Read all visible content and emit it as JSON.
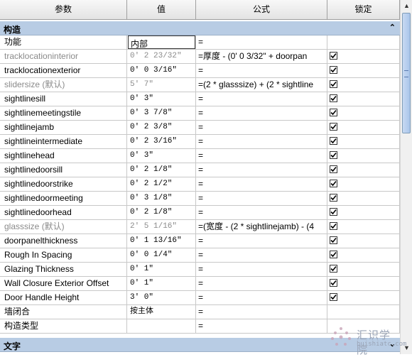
{
  "header": {
    "col_param": "参数",
    "col_value": "值",
    "col_formula": "公式",
    "col_lock": "锁定"
  },
  "groups": {
    "construction": "构造",
    "text": "文字",
    "collapse_icon": "chevron-double-up-icon"
  },
  "rows": [
    {
      "param": "功能",
      "value": "内部",
      "formula": "=",
      "checked": false,
      "editing": true,
      "gray": false
    },
    {
      "param": "tracklocationinterior",
      "value": "0'  2 23/32\"",
      "formula": "=厚度 - (0'  0 3/32\" + doorpan",
      "checked": true,
      "gray": true
    },
    {
      "param": "tracklocationexterior",
      "value": "0'  0 3/16\"",
      "formula": "=",
      "checked": true,
      "gray": false
    },
    {
      "param": "slidersize (默认)",
      "value": "5'  7\"",
      "formula": "=(2 * glasssize) + (2 * sightline",
      "checked": true,
      "gray": true
    },
    {
      "param": "sightlinesill",
      "value": "0'  3\"",
      "formula": "=",
      "checked": true,
      "gray": false
    },
    {
      "param": "sightlinemeetingstile",
      "value": "0'  3 7/8\"",
      "formula": "=",
      "checked": true,
      "gray": false
    },
    {
      "param": "sightlinejamb",
      "value": "0'  2 3/8\"",
      "formula": "=",
      "checked": true,
      "gray": false
    },
    {
      "param": "sightlineintermediate",
      "value": "0'  2 3/16\"",
      "formula": "=",
      "checked": true,
      "gray": false
    },
    {
      "param": "sightlinehead",
      "value": "0'  3\"",
      "formula": "=",
      "checked": true,
      "gray": false
    },
    {
      "param": "sightlinedoorsill",
      "value": "0'  2 1/8\"",
      "formula": "=",
      "checked": true,
      "gray": false
    },
    {
      "param": "sightlinedoorstrike",
      "value": "0'  2 1/2\"",
      "formula": "=",
      "checked": true,
      "gray": false
    },
    {
      "param": "sightlinedoormeeting",
      "value": "0'  3 1/8\"",
      "formula": "=",
      "checked": true,
      "gray": false
    },
    {
      "param": "sightlinedoorhead",
      "value": "0'  2 1/8\"",
      "formula": "=",
      "checked": true,
      "gray": false
    },
    {
      "param": "glasssize (默认)",
      "value": "2'  5 1/16\"",
      "formula": "=(宽度 - (2 * sightlinejamb) - (4",
      "checked": true,
      "gray": true
    },
    {
      "param": "doorpanelthickness",
      "value": "0'  1 13/16\"",
      "formula": "=",
      "checked": true,
      "gray": false
    },
    {
      "param": "Rough In Spacing",
      "value": "0'  0 1/4\"",
      "formula": "=",
      "checked": true,
      "gray": false
    },
    {
      "param": "Glazing Thickness",
      "value": "0'  1\"",
      "formula": "=",
      "checked": true,
      "gray": false
    },
    {
      "param": "Wall Closure Exterior Offset",
      "value": "0'  1\"",
      "formula": "=",
      "checked": true,
      "gray": false
    },
    {
      "param": "Door Handle Height",
      "value": "3'  0\"",
      "formula": "=",
      "checked": true,
      "gray": false
    },
    {
      "param": "墙闭合",
      "value": "按主体",
      "formula": "=",
      "checked": false,
      "gray": false
    },
    {
      "param": "构造类型",
      "value": "",
      "formula": "=",
      "checked": false,
      "gray": false
    }
  ],
  "scrollbar": {
    "up_icon": "arrow-up-icon",
    "down_icon": "arrow-down-icon"
  },
  "watermark": {
    "text_cn": "汇识学院",
    "text_en": "huishiatc.com",
    "logo_icon": "logo-icon"
  }
}
